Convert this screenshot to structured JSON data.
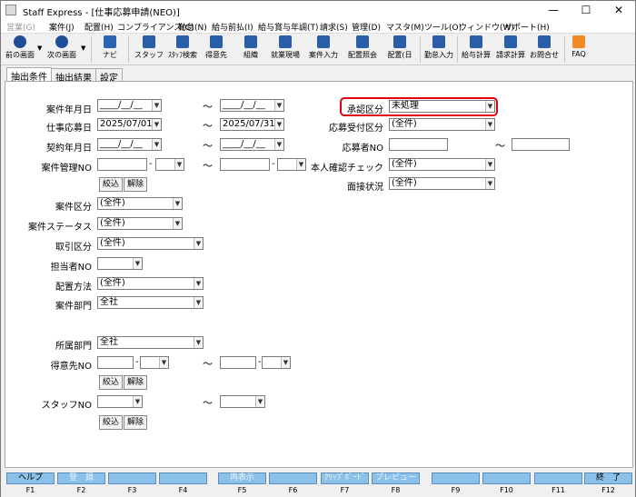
{
  "window": {
    "title": "Staff Express - [仕事応募申請(NEO)]",
    "minimize": "—",
    "maximize": "☐",
    "close": "✕"
  },
  "menu": [
    "営業(G)",
    "案件(J)",
    "配置(H)",
    "コンプライアンス(C)",
    "勤怠(N)",
    "給与前払(I)",
    "給与賞与年調(T)",
    "請求(S)",
    "管理(D)",
    "マスタ(M)",
    "ツール(O)",
    "ウィンドウ(W)",
    "サポート(H)"
  ],
  "toolbar": {
    "back": "前の画面",
    "next": "次の画面",
    "navi": "ナビ",
    "staff": "スタッフ",
    "staff_search": "ｽﾀｯﾌ検索",
    "client": "得意先",
    "org": "組織",
    "site": "就業現場",
    "job_entry": "案件入力",
    "assign_inquiry": "配置照会",
    "assign_day": "配置(日",
    "attendance": "勤怠入力",
    "payroll": "給与計算",
    "billing": "請求計算",
    "contact": "お問合せ",
    "faq": "FAQ"
  },
  "tabs": [
    "抽出条件",
    "抽出結果",
    "設定"
  ],
  "form": {
    "tilde": "〜",
    "dash": "-",
    "job_month_label": "案件年月日",
    "job_month_from": "____/__/__",
    "job_month_to": "____/__/__",
    "apply_date_label": "仕事応募日",
    "apply_date_from": "2025/07/01",
    "apply_date_to": "2025/07/31",
    "contract_label": "契約年月日",
    "contract_from": "____/__/__",
    "contract_to": "____/__/__",
    "job_mgmt_label": "案件管理NO",
    "narrow": "絞込",
    "release": "解除",
    "job_type_label": "案件区分",
    "job_type_value": "(全件)",
    "job_status_label": "案件ステータス",
    "job_status_value": "(全件)",
    "deal_label": "取引区分",
    "deal_value": "(全件)",
    "staff_in_charge_label": "担当者NO",
    "assign_method_label": "配置方法",
    "assign_method_value": "(全件)",
    "dept_label": "案件部門",
    "dept_value": "全社",
    "belong_label": "所属部門",
    "belong_value": "全社",
    "client_no_label": "得意先NO",
    "staff_no_label": "スタッフNO",
    "approval_label": "承認区分",
    "approval_value": "未処理",
    "reception_label": "応募受付区分",
    "reception_value": "(全件)",
    "applicant_label": "応募者NO",
    "identity_label": "本人確認チェック",
    "identity_value": "(全件)",
    "interview_label": "面接状況",
    "interview_value": "(全件)"
  },
  "fkeys": [
    {
      "label": "ヘルプ",
      "key": "F1"
    },
    {
      "label": "登　録",
      "key": "F2"
    },
    {
      "label": "",
      "key": "F3"
    },
    {
      "label": "",
      "key": "F4"
    },
    {
      "label": "再表示",
      "key": "F5"
    },
    {
      "label": "",
      "key": "F6"
    },
    {
      "label": "ｸﾘｯﾌﾟﾎﾞｰﾄﾞ",
      "key": "F7"
    },
    {
      "label": "プレビュー",
      "key": "F8"
    },
    {
      "label": "",
      "key": "F9"
    },
    {
      "label": "",
      "key": "F10"
    },
    {
      "label": "",
      "key": "F11"
    },
    {
      "label": "終　了",
      "key": "F12"
    }
  ],
  "colors": {
    "accent": "#8bc1e8",
    "highlight": "#e0000f"
  }
}
